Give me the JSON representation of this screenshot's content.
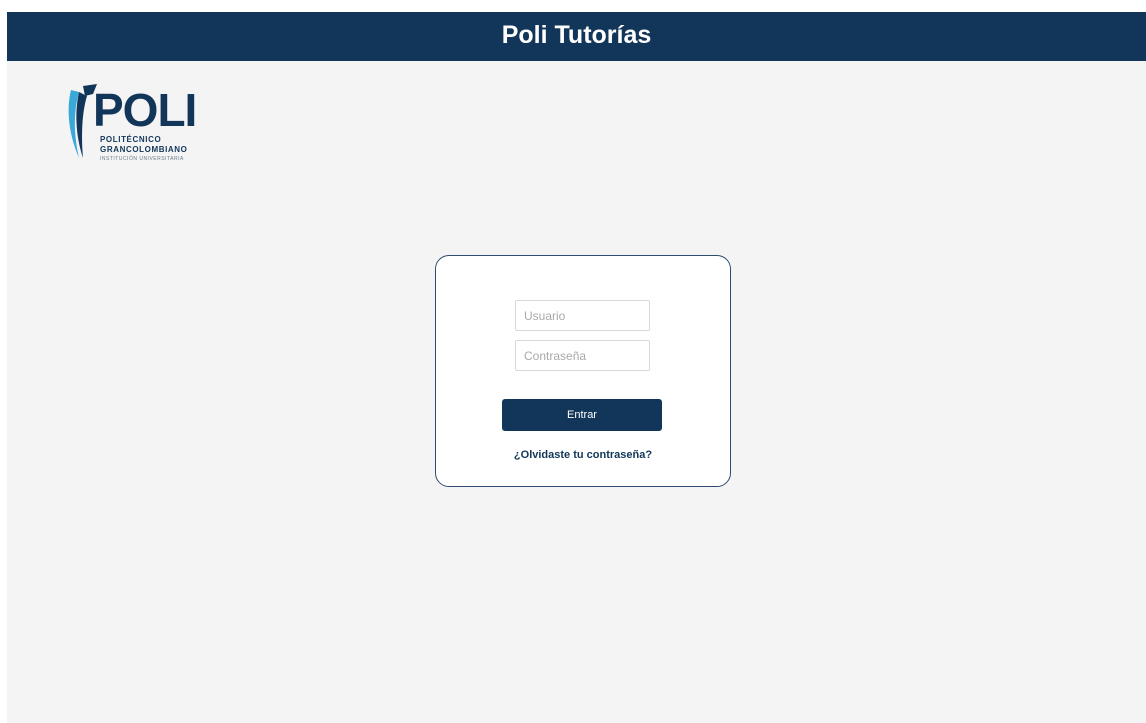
{
  "header": {
    "title": "Poli Tutorías"
  },
  "logo": {
    "word": "POLI",
    "line1": "POLITÉCNICO",
    "line2": "GRANCOLOMBIANO",
    "line3": "INSTITUCIÓN UNIVERSITARIA",
    "icon": "poli-logo-mark"
  },
  "login": {
    "username_placeholder": "Usuario",
    "username_value": "",
    "password_placeholder": "Contraseña",
    "password_value": "",
    "submit_label": "Entrar",
    "forgot_label": "¿Olvidaste tu contraseña?"
  },
  "colors": {
    "brand": "#12365a",
    "background": "#f4f4f4",
    "card_border": "#2d4b6e",
    "logo_accent": "#3aa8d8"
  }
}
